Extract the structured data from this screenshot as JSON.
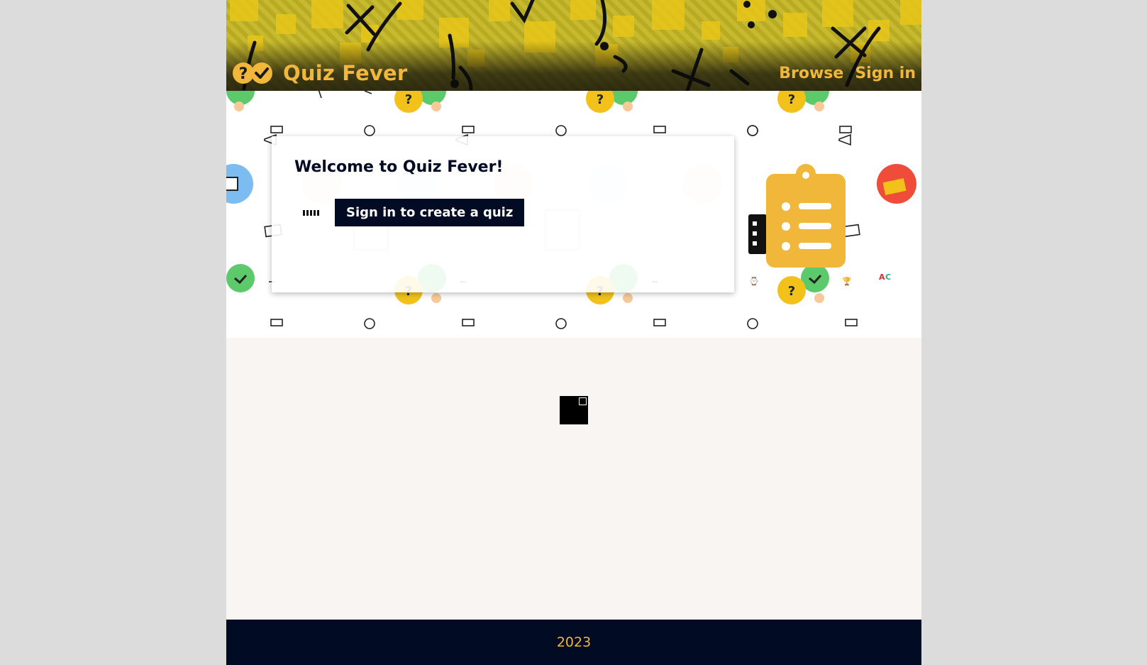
{
  "header": {
    "title": "Quiz Fever",
    "logo_icon": "question-check-logo-icon",
    "nav": [
      {
        "label": "Browse"
      },
      {
        "label": "Sign in"
      }
    ]
  },
  "hero": {
    "heading": "Welcome to Quiz Fever!",
    "cta_label": "Sign in to create a quiz",
    "illustration_icon": "clipboard-list-icon"
  },
  "footer": {
    "text": "2023"
  },
  "colors": {
    "brand_yellow": "#f0b73a",
    "navy": "#020b24",
    "page_bg": "#f8f5f3",
    "outer_bg": "#dcdcdc"
  }
}
